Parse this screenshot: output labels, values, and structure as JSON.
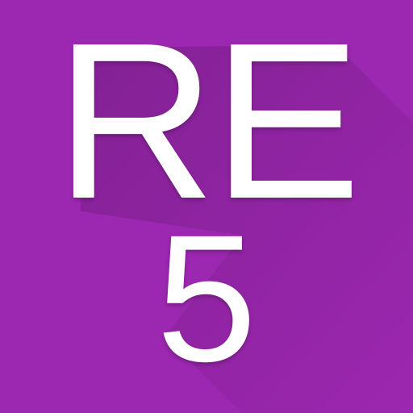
{
  "icon": {
    "title": "RE",
    "number": "5",
    "background_color": "#9c27b0",
    "text_color": "#ffffff"
  }
}
